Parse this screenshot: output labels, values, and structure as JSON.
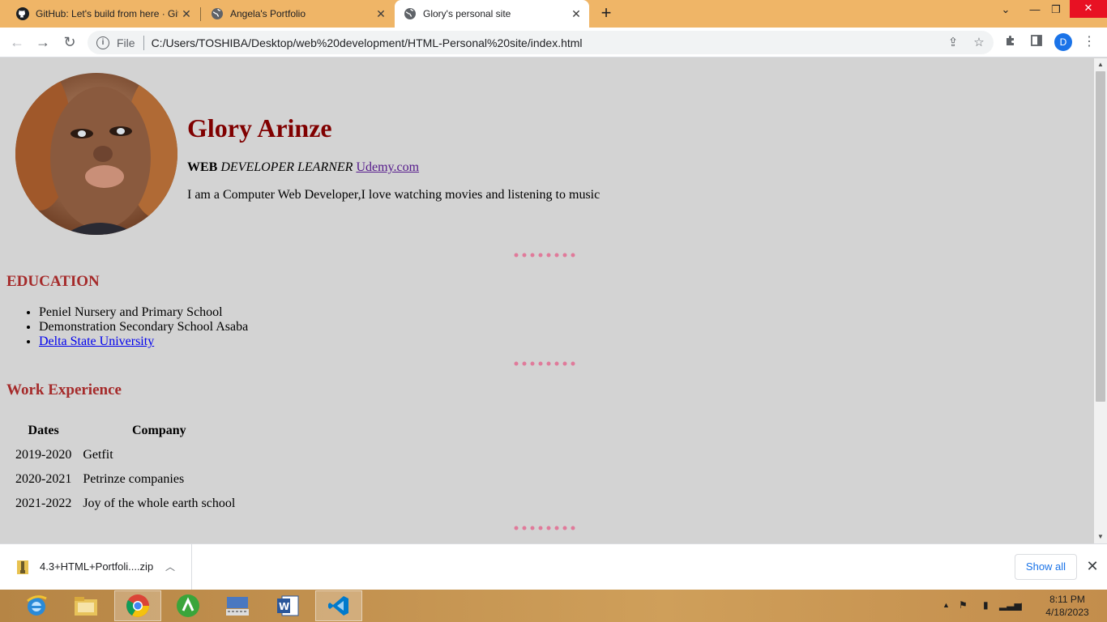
{
  "browser": {
    "tabs": [
      {
        "title": "GitHub: Let's build from here · GitHub",
        "icon": "github-icon",
        "active": false
      },
      {
        "title": "Angela's Portfolio",
        "icon": "globe-icon",
        "active": false
      },
      {
        "title": "Glory's personal site",
        "icon": "globe-icon",
        "active": true
      }
    ],
    "address": {
      "scheme": "File",
      "url": "C:/Users/TOSHIBA/Desktop/web%20development/HTML-Personal%20site/index.html"
    },
    "profile_initial": "D"
  },
  "page": {
    "name": "Glory Arinze",
    "role": {
      "bold": "WEB",
      "italic": "DEVELOPER LEARNER",
      "link": "Udemy.com"
    },
    "intro": "I am a Computer Web Developer,I love watching movies and listening to music",
    "education": {
      "heading": "EDUCATION",
      "items": [
        {
          "text": "Peniel Nursery and Primary School",
          "link": false
        },
        {
          "text": "Demonstration Secondary School Asaba",
          "link": false
        },
        {
          "text": "Delta State University",
          "link": true
        }
      ]
    },
    "work": {
      "heading": "Work Experience",
      "columns": [
        "Dates",
        "Company"
      ],
      "rows": [
        [
          "2019-2020",
          "Getfit"
        ],
        [
          "2020-2021",
          "Petrinze companies"
        ],
        [
          "2021-2022",
          "Joy of the whole earth school"
        ]
      ]
    }
  },
  "downloads": {
    "file": "4.3+HTML+Portfoli....zip",
    "show_all": "Show all"
  },
  "taskbar": {
    "time": "8:11 PM",
    "date": "4/18/2023"
  },
  "colors": {
    "tabstrip": "#efb567",
    "page_bg": "#d3d3d3",
    "name": "#800000",
    "headings": "#a52a2a",
    "hr_dots": "#e07a9a"
  }
}
